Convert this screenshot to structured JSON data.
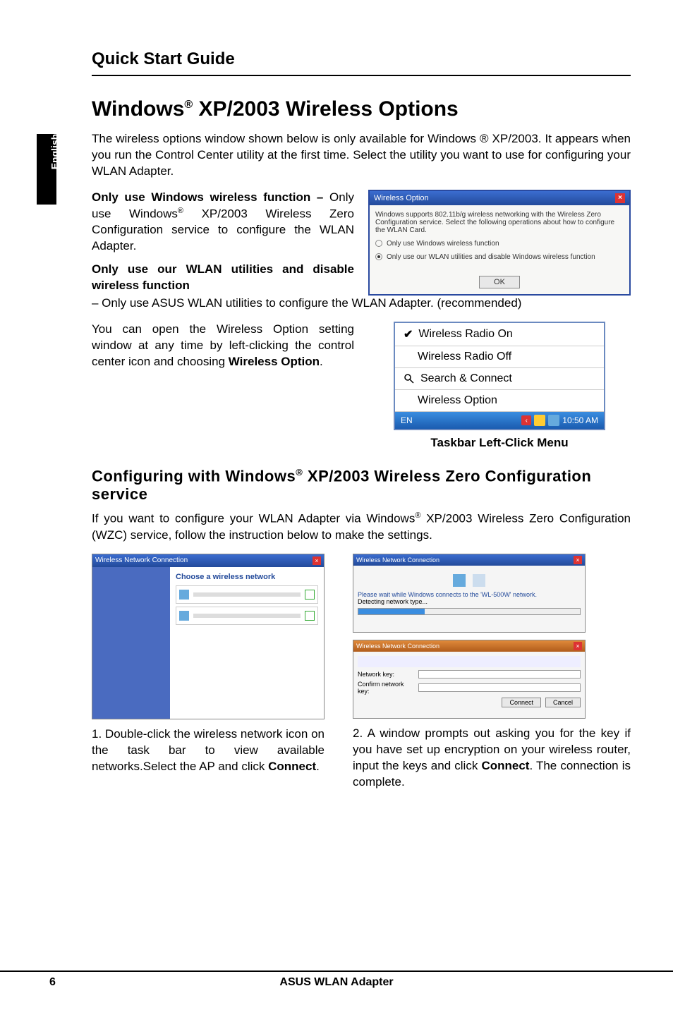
{
  "header": {
    "title": "Quick Start Guide"
  },
  "sidebar": {
    "lang": "English"
  },
  "main_title_pre": "Windows",
  "main_title_sup": "®",
  "main_title_post": " XP/2003 Wireless Options",
  "intro_p1": "The wireless options window shown below is only available for Windows ® XP/2003. It appears when you run the Control Center utility at the first time. Select the utility you want to use for configuring your WLAN Adapter.",
  "opt1_title": "Only use Windows wireless function – ",
  "opt1_body_pre": "Only use Windows",
  "opt1_body_sup": "®",
  "opt1_body_post": " XP/2003 Wireless Zero Configuration service to configure the WLAN Adapter.",
  "opt2_title": "Only use our WLAN utilities and disable wireless function",
  "opt2_body": "– Only use ASUS WLAN utilities to configure the WLAN Adapter. (recommended)",
  "open_option_p": "You can open the Wireless Option setting window at any time by left-clicking the control center icon and choosing ",
  "open_option_bold": "Wireless Option",
  "open_option_end": ".",
  "dialog1": {
    "title": "Wireless Option",
    "desc": "Windows supports 802.11b/g wireless networking with the Wireless Zero Configuration service. Select the following operations about how to configure the WLAN Card.",
    "radio1": "Only use Windows wireless function",
    "radio2": "Only use our WLAN utilities and disable Windows wireless function",
    "ok": "OK"
  },
  "taskmenu": {
    "i1": "Wireless Radio On",
    "i2": "Wireless Radio Off",
    "i3": "Search & Connect",
    "i4": "Wireless Option",
    "tray_lang": "EN",
    "tray_time": "10:50 AM"
  },
  "taskbar_caption": "Taskbar Left-Click Menu",
  "sub_pre": "Configuring with Windows",
  "sub_sup": "®",
  "sub_post": " XP/2003 Wireless Zero Configuration service",
  "sub_body_pre": "If you want to configure your WLAN Adapter via Windows",
  "sub_body_sup": "®",
  "sub_body_post": " XP/2003 Wireless Zero Configuration (WZC) service, follow the instruction below to make the settings.",
  "thumb1": {
    "title": "Wireless Network Connection",
    "heading": "Choose a wireless network"
  },
  "thumb2a": {
    "title": "Wireless Network Connection",
    "line": "Please wait while Windows connects to the 'WL-500W' network.",
    "sub": "Detecting network type..."
  },
  "thumb2b": {
    "title": "Wireless Network Connection",
    "label1": "Network key:",
    "label2": "Confirm network key:",
    "btn1": "Connect",
    "btn2": "Cancel"
  },
  "step1_pre": "1. Double-click the wireless network icon on the task bar to view available networks.Select the AP and click ",
  "step1_bold": "Connect",
  "step1_end": ".",
  "step2_pre": "2. A window prompts out asking you for the key if you have set up encryption on your wireless router, input the keys and click ",
  "step2_bold": "Connect",
  "step2_end": ". The connection is complete.",
  "footer": {
    "page": "6",
    "title": "ASUS WLAN Adapter"
  }
}
